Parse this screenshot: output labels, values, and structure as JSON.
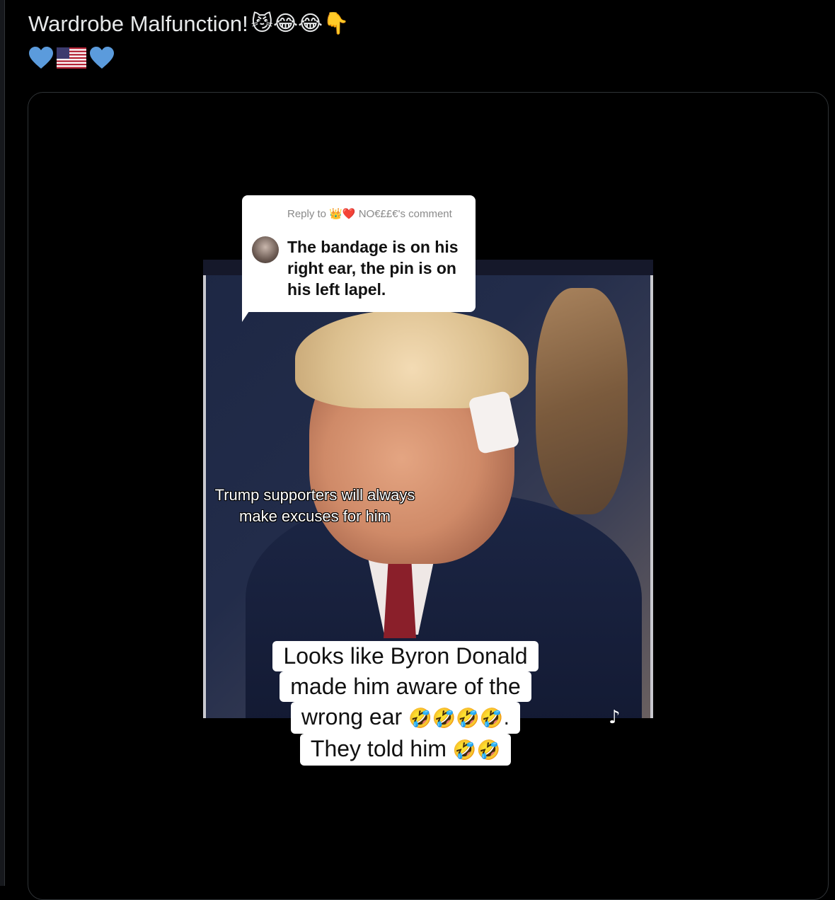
{
  "post": {
    "title": "Wardrobe Malfunction!",
    "title_emojis": "😼😂😂👇",
    "second_line_icons": [
      "blue-heart-icon",
      "us-flag-icon",
      "blue-heart-icon"
    ],
    "colors": {
      "heart": "#5b9bdc",
      "text": "#e7e9ea",
      "background": "#000000"
    }
  },
  "video": {
    "reply_header": "Reply to 👑❤️ NO€££€'s comment",
    "reply_text": "The bandage is on his right ear, the pin is on his left lapel.",
    "overlay_caption": "Trump supporters will always make excuses for him",
    "bottom_caption": {
      "line1": "Looks like Byron Donald",
      "line2": "made him aware of the",
      "line3_text": "wrong ear",
      "line3_emojis": "🤣🤣🤣🤣.",
      "line4_text": "They told him",
      "line4_emojis": "🤣🤣"
    }
  }
}
